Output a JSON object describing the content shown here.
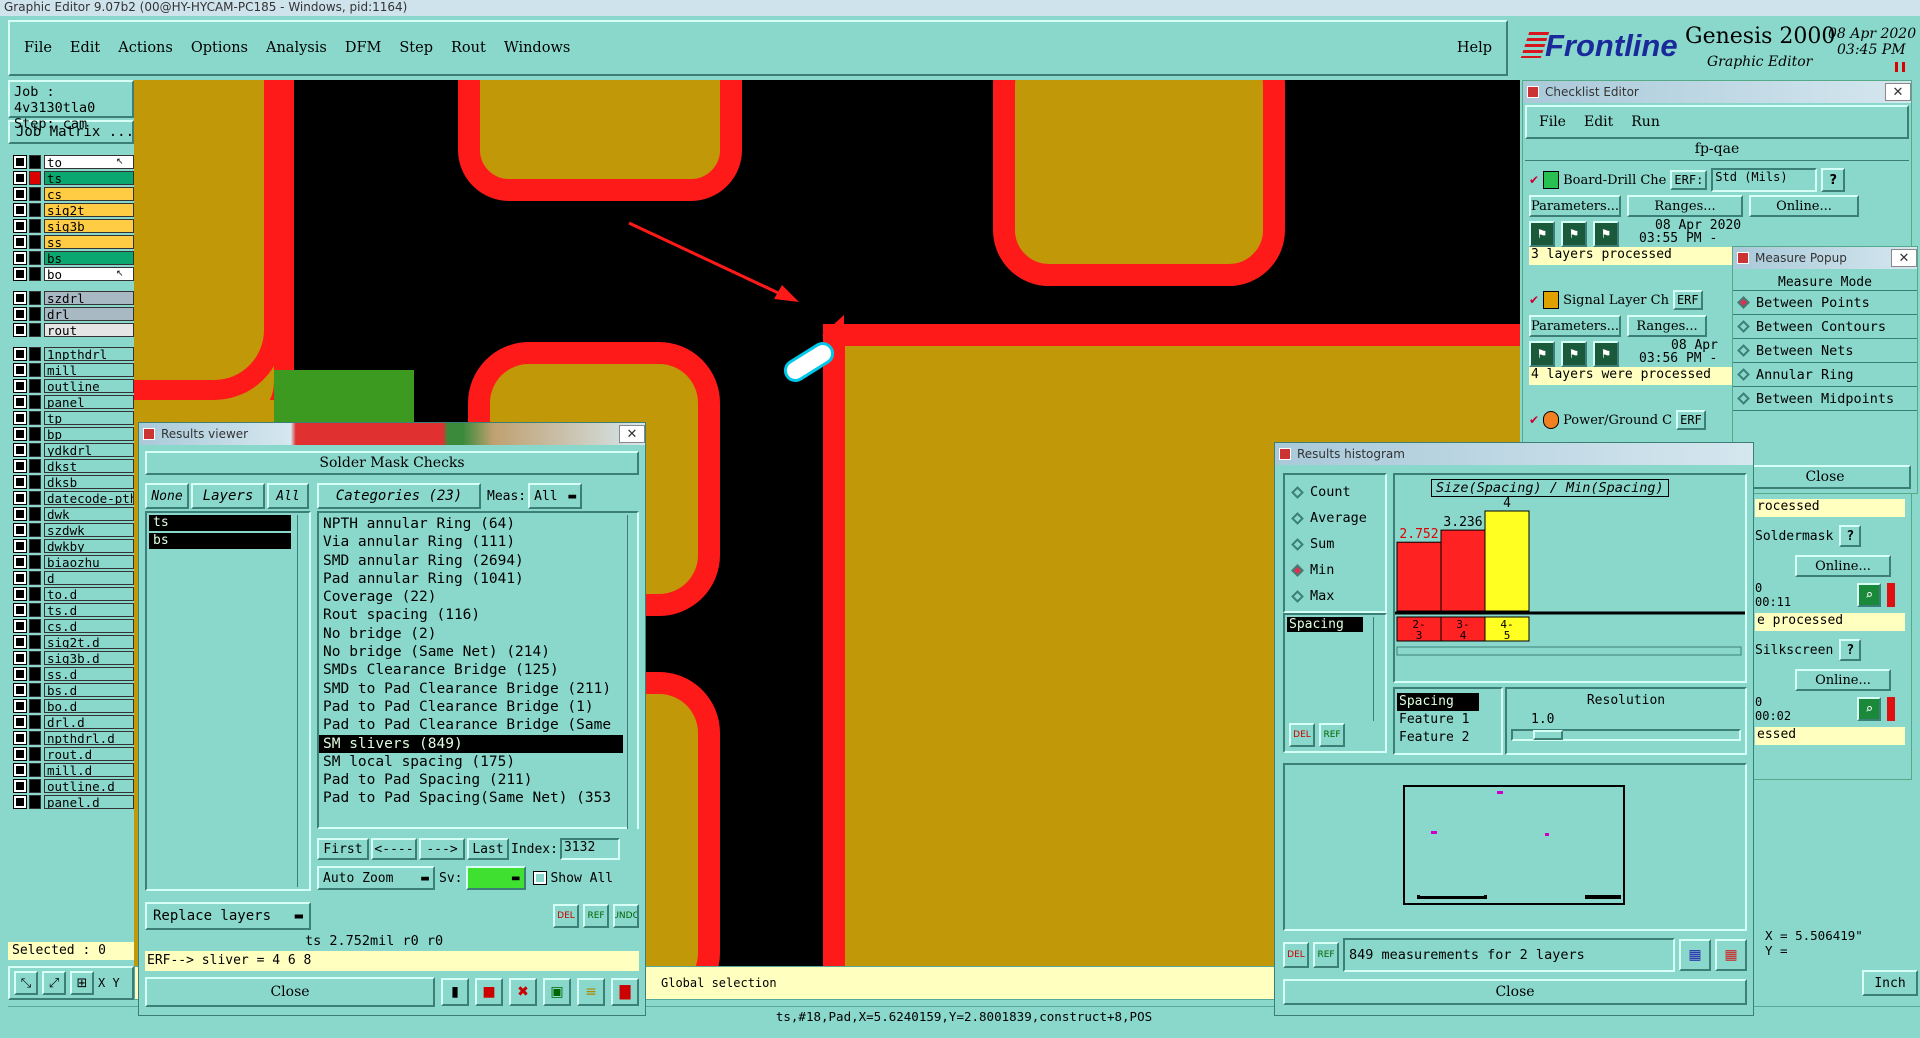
{
  "window_title": "Graphic Editor 9.07b2 (00@HY-HYCAM-PC185 - Windows, pid:1164)",
  "menubar": {
    "items": [
      "File",
      "Edit",
      "Actions",
      "Options",
      "Analysis",
      "DFM",
      "Step",
      "Rout",
      "Windows"
    ],
    "help": "Help"
  },
  "brand": {
    "logo": "Frontline",
    "product": "Genesis 2000",
    "subtitle": "Graphic Editor",
    "date": "08 Apr 2020",
    "time": "03:45 PM"
  },
  "left_panel": {
    "job": "Job : 4v3130tla0",
    "step": "Step: cam",
    "job_matrix": "Job Matrix ...",
    "selected": "Selected : 0",
    "coord_label": "X Y",
    "layers_group1": [
      {
        "name": "to",
        "color": "#ffffff",
        "mark": "↖",
        "sel": false
      },
      {
        "name": "ts",
        "color": "#0aa870",
        "mark": "",
        "sel": true
      },
      {
        "name": "cs",
        "color": "#ffcc44",
        "mark": "",
        "sel": false
      },
      {
        "name": "sig2t",
        "color": "#ffcc44",
        "mark": "",
        "sel": false
      },
      {
        "name": "sig3b",
        "color": "#ffcc44",
        "mark": "",
        "sel": false
      },
      {
        "name": "ss",
        "color": "#ffcc44",
        "mark": "",
        "sel": false
      },
      {
        "name": "bs",
        "color": "#0aa870",
        "mark": "",
        "sel": false
      },
      {
        "name": "bo",
        "color": "#ffffff",
        "mark": "↖",
        "sel": false
      }
    ],
    "layers_group2": [
      {
        "name": "szdrl",
        "color": "#a9b9c4"
      },
      {
        "name": "drl",
        "color": "#a9b9c4"
      },
      {
        "name": "rout",
        "color": "#e5e5e5"
      }
    ],
    "layers_group3": [
      "1npthdrl",
      "mill",
      "outline",
      "panel",
      "tp",
      "bp",
      "ydkdrl",
      "dkst",
      "dksb",
      "datecode-pth",
      "dwk",
      "szdwk",
      "dwkby",
      "biaozhu",
      "d",
      "to.d",
      "ts.d",
      "cs.d",
      "sig2t.d",
      "sig3b.d",
      "ss.d",
      "bs.d",
      "bo.d",
      "drl.d",
      "npthdrl.d",
      "rout.d",
      "mill.d",
      "outline.d",
      "panel.d"
    ]
  },
  "checklist_editor": {
    "title": "Checklist Editor",
    "menu": [
      "File",
      "Edit",
      "Run"
    ],
    "name": "fp-qae",
    "actions": [
      {
        "name": "Board-Drill Che",
        "erf": "ERF:",
        "std": "Std (Mils)",
        "date": "08 Apr 2020",
        "time": "03:55 PM -",
        "status": "3 layers processed"
      },
      {
        "name": "Signal Layer Ch",
        "erf": "ERF",
        "date": "08 Apr",
        "time": "03:56 PM -",
        "status": "4 layers were processed"
      },
      {
        "name": "Power/Ground C",
        "erf": "ERF"
      }
    ],
    "parameters": "Parameters...",
    "ranges": "Ranges...",
    "online": "Online...",
    "lower": {
      "items": [
        "rocessed",
        "Soldermask",
        "Online...",
        "0",
        "00:11",
        "e processed",
        "Silkscreen",
        "Online...",
        "0",
        "00:02",
        "essed"
      ]
    }
  },
  "measure_popup": {
    "title": "Measure Popup",
    "heading": "Measure Mode",
    "modes": [
      "Between Points",
      "Between Contours",
      "Between Nets",
      "Annular Ring",
      "Between Midpoints"
    ],
    "active": 0,
    "close": "Close"
  },
  "results_viewer": {
    "title": "Results viewer",
    "header": "Solder Mask Checks",
    "none": "None",
    "layers": "Layers",
    "all": "All",
    "layer_list": [
      "ts",
      "bs"
    ],
    "categories_label": "Categories (23)",
    "meas_label": "Meas:",
    "meas_value": "All",
    "categories": [
      "NPTH annular Ring (64)",
      "Via annular Ring (111)",
      "SMD annular Ring (2694)",
      "Pad annular Ring (1041)",
      "Coverage (22)",
      "Rout spacing (116)",
      "No bridge (2)",
      "No bridge (Same Net) (214)",
      "SMDs Clearance Bridge (125)",
      "SMD to Pad Clearance Bridge (211)",
      "Pad to Pad Clearance Bridge (1)",
      "Pad to Pad Clearance Bridge (Same",
      "SM slivers (849)",
      "SM local spacing (175)",
      "Pad to Pad Spacing (211)",
      "Pad to Pad Spacing(Same Net) (353"
    ],
    "selected_category": 12,
    "nav": {
      "first": "First",
      "prev": "<----",
      "next": "--->",
      "last": "Last",
      "index_label": "Index:",
      "index_value": "3132"
    },
    "auto_zoom": "Auto Zoom",
    "sv_label": "Sv:",
    "show_all": "Show All",
    "replace_layers": "Replace layers",
    "status": "ts 2.752mil   r0   r0",
    "erf": "ERF--> sliver = 4 6 8",
    "close": "Close"
  },
  "results_histogram": {
    "title": "Results histogram",
    "modes": [
      "Count",
      "Average",
      "Sum",
      "Min",
      "Max"
    ],
    "active_mode": 3,
    "list": [
      "Spacing"
    ],
    "chart_title": "Size(Spacing) / Min(Spacing)",
    "sizes": [
      "Spacing",
      "Feature 1",
      "Feature 2"
    ],
    "resolution_label": "Resolution",
    "resolution_value": "1.0",
    "measurements": "849 measurements for 2 layers",
    "close": "Close"
  },
  "chart_data": {
    "type": "bar",
    "title": "Size(Spacing) / Min(Spacing)",
    "categories": [
      "2-3",
      "3-4",
      "4-5"
    ],
    "values": [
      2.752,
      3.236,
      4
    ],
    "colors": [
      "#ff2222",
      "#ff2222",
      "#ffff22"
    ]
  },
  "main_status": {
    "global": "Global selection",
    "coords": "ts,#18,Pad,X=5.6240159,Y=2.8001839,construct+8,POS",
    "xy_x": "X = 5.506419\"",
    "xy_y": "Y =",
    "units": "Inch"
  },
  "colors": {
    "background": "#8ad8cc",
    "pad": "#c09808",
    "mask": "#ff1a1a",
    "board": "#000000"
  }
}
